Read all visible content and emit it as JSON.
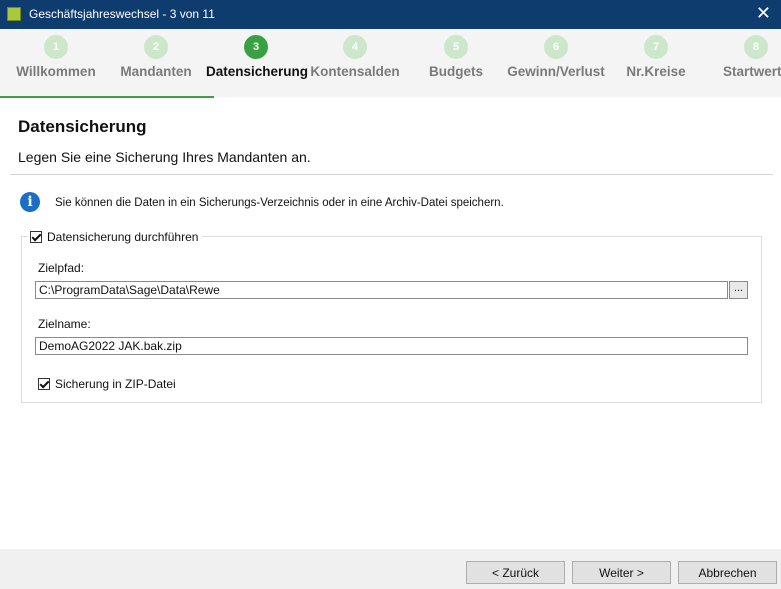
{
  "window": {
    "title": "Geschäftsjahreswechsel - 3 von 11",
    "close_glyph": "✕"
  },
  "steps": [
    {
      "number": "1",
      "label": "Willkommen"
    },
    {
      "number": "2",
      "label": "Mandanten"
    },
    {
      "number": "3",
      "label": "Datensicherung",
      "active": true
    },
    {
      "number": "4",
      "label": "Kontensalden"
    },
    {
      "number": "5",
      "label": "Budgets"
    },
    {
      "number": "6",
      "label": "Gewinn/Verlust"
    },
    {
      "number": "7",
      "label": "Nr.Kreise"
    },
    {
      "number": "8",
      "label": "Startwerte"
    }
  ],
  "page": {
    "heading": "Datensicherung",
    "subheading": "Legen Sie eine Sicherung Ihres Mandanten an.",
    "info_text": "Sie können die Daten in ein Sicherungs-Verzeichnis oder in eine Archiv-Datei speichern."
  },
  "backup": {
    "perform_label": "Datensicherung durchführen",
    "perform_checked": true,
    "target_path_label": "Zielpfad:",
    "target_path_value": "C:\\ProgramData\\Sage\\Data\\Rewe",
    "browse_label": "...",
    "target_name_label": "Zielname:",
    "target_name_value": "DemoAG2022 JAK.bak.zip",
    "zip_label": "Sicherung in ZIP-Datei",
    "zip_checked": true
  },
  "buttons": {
    "back": "< Zurück",
    "next": "Weiter >",
    "cancel": "Abbrechen"
  },
  "colors": {
    "titlebar": "#0f3c6e",
    "accent_green": "#3aa142",
    "step_inactive": "#cde7cb",
    "info_blue": "#1b6ec2"
  }
}
